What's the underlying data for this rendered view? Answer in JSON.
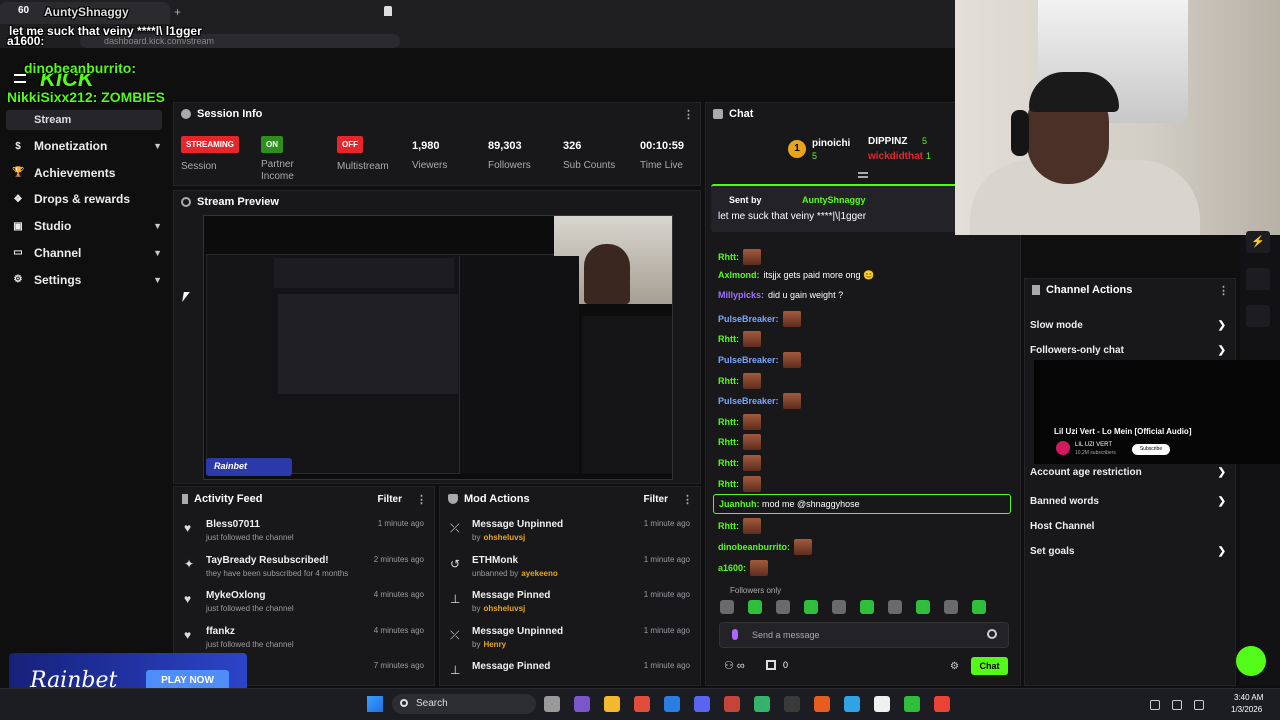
{
  "browser": {
    "tab_title": "AuntyShnaggy",
    "tab_count_badge": "60",
    "url": "dashboard.kick.com/stream",
    "new_tab": "+"
  },
  "overlay": {
    "line1_user": "a1600:",
    "line1_msg": "let me suck that veiny ****l\\ l1gger",
    "line2_user": "dinobeanburrito:",
    "line3": "NikkiSixx212: ZOMBIES",
    "logo": "KICK"
  },
  "sidebar": {
    "stream_label": "Stream",
    "items": [
      {
        "label": "Monetization",
        "icon": "dollar-icon",
        "chevron": true
      },
      {
        "label": "Achievements",
        "icon": "trophy-icon",
        "chevron": false
      },
      {
        "label": "Drops & rewards",
        "icon": "gift-icon",
        "chevron": false
      },
      {
        "label": "Studio",
        "icon": "video-icon",
        "chevron": true
      },
      {
        "label": "Channel",
        "icon": "tv-icon",
        "chevron": true
      },
      {
        "label": "Settings",
        "icon": "gear-icon",
        "chevron": true
      }
    ]
  },
  "session": {
    "title": "Session Info",
    "streaming_pill": "STREAMING",
    "streaming_label": "Session",
    "partner_pill": "ON",
    "partner_label": "Partner Income",
    "multistream_pill": "OFF",
    "multistream_label": "Multistream",
    "viewers": "1,980",
    "viewers_label": "Viewers",
    "followers": "89,303",
    "followers_label": "Followers",
    "subs": "326",
    "subs_label": "Sub Counts",
    "time": "00:10:59",
    "time_label": "Time Live"
  },
  "preview": {
    "title": "Stream Preview",
    "sponsor": "Rainbet"
  },
  "activity": {
    "title": "Activity Feed",
    "filter": "Filter",
    "items": [
      {
        "name": "Bless07011",
        "sub": "just followed the channel",
        "ago": "1 minute ago",
        "icon": "heart-icon"
      },
      {
        "name": "TayBready Resubscribed!",
        "sub": "they have been subscribed for 4 months",
        "ago": "2 minutes ago",
        "icon": "star-icon"
      },
      {
        "name": "MykeOxlong",
        "sub": "just followed the channel",
        "ago": "4 minutes ago",
        "icon": "heart-icon"
      },
      {
        "name": "ffankz",
        "sub": "just followed the channel",
        "ago": "4 minutes ago",
        "icon": "heart-icon"
      },
      {
        "name": "eal",
        "sub": "",
        "ago": "7 minutes ago",
        "icon": "heart-icon"
      }
    ]
  },
  "mod": {
    "title": "Mod Actions",
    "filter": "Filter",
    "items": [
      {
        "action": "Message Unpinned",
        "by": "by",
        "user": "ohsheluvsj",
        "ago": "1 minute ago",
        "icon": "unpin-icon"
      },
      {
        "action": "ETHMonk",
        "by": "unbanned by",
        "user": "ayekeeno",
        "ago": "1 minute ago",
        "icon": "undo-icon"
      },
      {
        "action": "Message Pinned",
        "by": "by",
        "user": "ohsheluvsj",
        "ago": "1 minute ago",
        "icon": "pin-icon"
      },
      {
        "action": "Message Unpinned",
        "by": "by",
        "user": "Henry",
        "ago": "1 minute ago",
        "icon": "unpin-icon"
      },
      {
        "action": "Message Pinned",
        "by": "",
        "user": "",
        "ago": "1 minute ago",
        "icon": "pin-icon"
      }
    ]
  },
  "chat": {
    "title": "Chat",
    "leader1_rank": "1",
    "leader1_name": "pinoichi",
    "leader1_count": "5",
    "leader2_name": "DIPPINZ",
    "leader2_count": "5",
    "leader3_name": "wickdidthat",
    "leader3_count": "1",
    "pinned_sent_by": "Sent by",
    "pinned_user": "AuntyShnaggy",
    "pinned_msg": "let me suck that veiny ****|\\|1gger",
    "messages": [
      {
        "user": "Rhtt:",
        "text": "",
        "color": "#53fc18",
        "emote": true
      },
      {
        "user": "Axlmond:",
        "text": "itsjjx gets paid more ong 😊",
        "color": "#53fc18",
        "emote": false
      },
      {
        "user": "Millypicks:",
        "text": "did u gain weight ?",
        "color": "#a070ff",
        "emote": false
      },
      {
        "user": "PulseBreaker:",
        "text": "",
        "color": "#7aa6ff",
        "emote": true
      },
      {
        "user": "Rhtt:",
        "text": "",
        "color": "#53fc18",
        "emote": true
      },
      {
        "user": "PulseBreaker:",
        "text": "",
        "color": "#7aa6ff",
        "emote": true
      },
      {
        "user": "Rhtt:",
        "text": "",
        "color": "#53fc18",
        "emote": true
      },
      {
        "user": "PulseBreaker:",
        "text": "",
        "color": "#7aa6ff",
        "emote": true
      },
      {
        "user": "Rhtt:",
        "text": "",
        "color": "#53fc18",
        "emote": true
      },
      {
        "user": "Rhtt:",
        "text": "",
        "color": "#53fc18",
        "emote": true
      },
      {
        "user": "Rhtt:",
        "text": "",
        "color": "#53fc18",
        "emote": true
      },
      {
        "user": "Rhtt:",
        "text": "",
        "color": "#53fc18",
        "emote": true
      }
    ],
    "highlight_user": "Juanhuh:",
    "highlight_msg": "mod me @shnaggyhose",
    "after": [
      {
        "user": "Rhtt:",
        "text": "",
        "color": "#53fc18",
        "emote": true
      },
      {
        "user": "dinobeanburrito:",
        "text": "",
        "color": "#53fc18",
        "emote": true
      },
      {
        "user": "a1600:",
        "text": "",
        "color": "#53fc18",
        "emote": true
      }
    ],
    "followers_only": "Followers only",
    "input_placeholder": "Send a message",
    "count_infinite": "0",
    "count_gift": "0",
    "send_label": "Chat"
  },
  "channel_actions": {
    "title": "Channel Actions",
    "items": [
      {
        "label": "Slow mode",
        "chevron": true
      },
      {
        "label": "Followers-only chat",
        "chevron": true
      },
      {
        "label": "Account age restriction",
        "chevron": true
      },
      {
        "label": "Banned words",
        "chevron": true
      },
      {
        "label": "Host Channel",
        "chevron": false
      },
      {
        "label": "Set goals",
        "chevron": true
      }
    ]
  },
  "music": {
    "title": "Lil Uzi Vert - Lo Mein [Official Audio]",
    "channel": "LIL UZI VERT",
    "subs": "10.2M subscribers",
    "subscribe": "Subscribe"
  },
  "ad": {
    "brand": "Rainbet",
    "cta": "PLAY NOW"
  },
  "taskbar": {
    "search": "Search",
    "time": "3:40 AM",
    "date": "1/3/2026"
  },
  "colors": {
    "kick_green": "#53fc18",
    "streaming_red": "#e5262b",
    "bg": "#0f0f10",
    "panel": "#18181b"
  }
}
